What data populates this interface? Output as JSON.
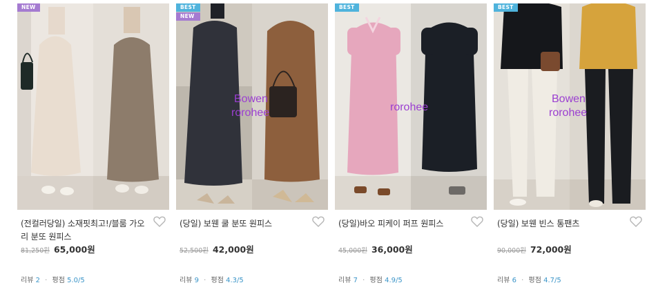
{
  "products": [
    {
      "badges": [
        "NEW"
      ],
      "title": "(전컬러당일) 소재핏최고!/블룸 가오리 분또 원피스",
      "original_price": "81,250원",
      "sale_price": "65,000원",
      "review_label": "리뷰",
      "review_count": "2",
      "rating_label": "평점",
      "rating": "5.0",
      "rating_max": "/5",
      "watermark": []
    },
    {
      "badges": [
        "BEST",
        "NEW"
      ],
      "title": "(당일) 보웬 쿨 분또 원피스",
      "original_price": "52,500원",
      "sale_price": "42,000원",
      "review_label": "리뷰",
      "review_count": "9",
      "rating_label": "평점",
      "rating": "4.3",
      "rating_max": "/5",
      "watermark": [
        "Bowen",
        "rorohee"
      ]
    },
    {
      "badges": [
        "BEST"
      ],
      "title": "(당일)바오 피케이 퍼프 원피스",
      "original_price": "45,000원",
      "sale_price": "36,000원",
      "review_label": "리뷰",
      "review_count": "7",
      "rating_label": "평점",
      "rating": "4.9",
      "rating_max": "/5",
      "watermark": [
        "rorohee"
      ]
    },
    {
      "badges": [
        "BEST"
      ],
      "title": "(당일) 보웬 빈스 통팬츠",
      "original_price": "90,000원",
      "sale_price": "72,000원",
      "review_label": "리뷰",
      "review_count": "6",
      "rating_label": "평점",
      "rating": "4.7",
      "rating_max": "/5",
      "watermark": [
        "Bowen",
        "rorohee"
      ]
    }
  ],
  "colors": {
    "badge_new": "#a57bd1",
    "badge_best": "#4fb3dc",
    "rating_value": "#3a94c8",
    "watermark": "#9b3fd1"
  },
  "icons": {
    "wishlist": "heart-outline-icon"
  }
}
